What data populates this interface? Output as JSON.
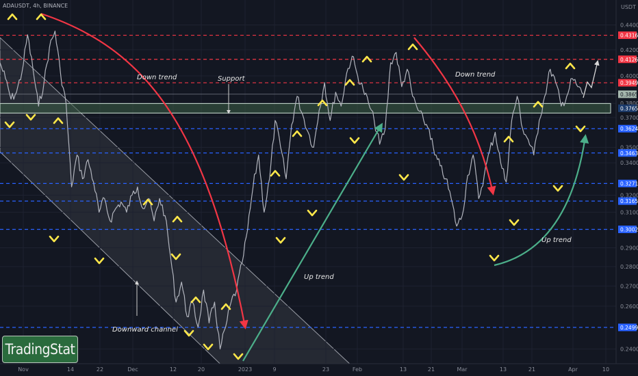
{
  "symbol_line": "ADAUSDT, 4h, BINANCE",
  "brand": "TradingStat",
  "colors": {
    "background": "#131722",
    "price_line": "#b2b5be",
    "resistance": "#f23645",
    "support": "#2962ff",
    "arrow_down": "#f23645",
    "arrow_up": "#4caf8a",
    "marker": "#ffe74a",
    "support_zone": "#3c5e46"
  },
  "chart_data": {
    "type": "line",
    "title": "ADAUSDT, 4h, BINANCE",
    "xlabel": "",
    "ylabel": "USDT",
    "y_scale": "log",
    "ylim": [
      0.2335,
      0.461
    ],
    "x_ticks": [
      "Nov",
      "14",
      "22",
      "Dec",
      "12",
      "20",
      "2023",
      "9",
      "23",
      "Feb",
      "13",
      "21",
      "Mar",
      "13",
      "21",
      "Apr",
      "10"
    ],
    "y_ticks": [
      "0.4400",
      "0.4200",
      "0.4000",
      "0.3800",
      "0.3700",
      "0.3500",
      "0.3400",
      "0.3200",
      "0.3100",
      "0.2900",
      "0.2800",
      "0.2700",
      "0.2600",
      "0.2400"
    ],
    "resistance_levels": [
      "0.4316",
      "0.4126",
      "0.3949"
    ],
    "support_levels": [
      "0.3624",
      "0.3463",
      "0.3271",
      "0.3165",
      "0.3002",
      "0.2499"
    ],
    "support_zone_level": "0.3765",
    "current_price": "0.3865",
    "annotations": [
      "Down trend",
      "Support",
      "Down trend",
      "Up trend",
      "Up trend",
      "Downward channel"
    ],
    "series": [
      {
        "values": [
          0.41,
          0.398,
          0.383,
          0.388,
          0.403,
          0.432,
          0.405,
          0.378,
          0.395,
          0.422,
          0.435,
          0.402,
          0.38,
          0.325,
          0.345,
          0.33,
          0.342,
          0.328,
          0.31,
          0.318,
          0.305,
          0.312,
          0.316,
          0.31,
          0.32,
          0.325,
          0.312,
          0.318,
          0.305,
          0.318,
          0.308,
          0.285,
          0.262,
          0.272,
          0.255,
          0.262,
          0.25,
          0.268,
          0.252,
          0.262,
          0.24,
          0.25,
          0.262,
          0.268,
          0.282,
          0.3,
          0.325,
          0.345,
          0.31,
          0.33,
          0.368,
          0.35,
          0.33,
          0.365,
          0.385,
          0.372,
          0.36,
          0.35,
          0.375,
          0.395,
          0.368,
          0.388,
          0.378,
          0.402,
          0.415,
          0.4,
          0.39,
          0.38,
          0.368,
          0.352,
          0.362,
          0.41,
          0.418,
          0.392,
          0.405,
          0.385,
          0.375,
          0.368,
          0.362,
          0.345,
          0.338,
          0.33,
          0.318,
          0.302,
          0.308,
          0.332,
          0.345,
          0.318,
          0.332,
          0.348,
          0.36,
          0.34,
          0.328,
          0.368,
          0.385,
          0.362,
          0.355,
          0.345,
          0.368,
          0.385,
          0.405,
          0.395,
          0.378,
          0.385,
          0.398,
          0.392,
          0.3865
        ]
      }
    ]
  }
}
